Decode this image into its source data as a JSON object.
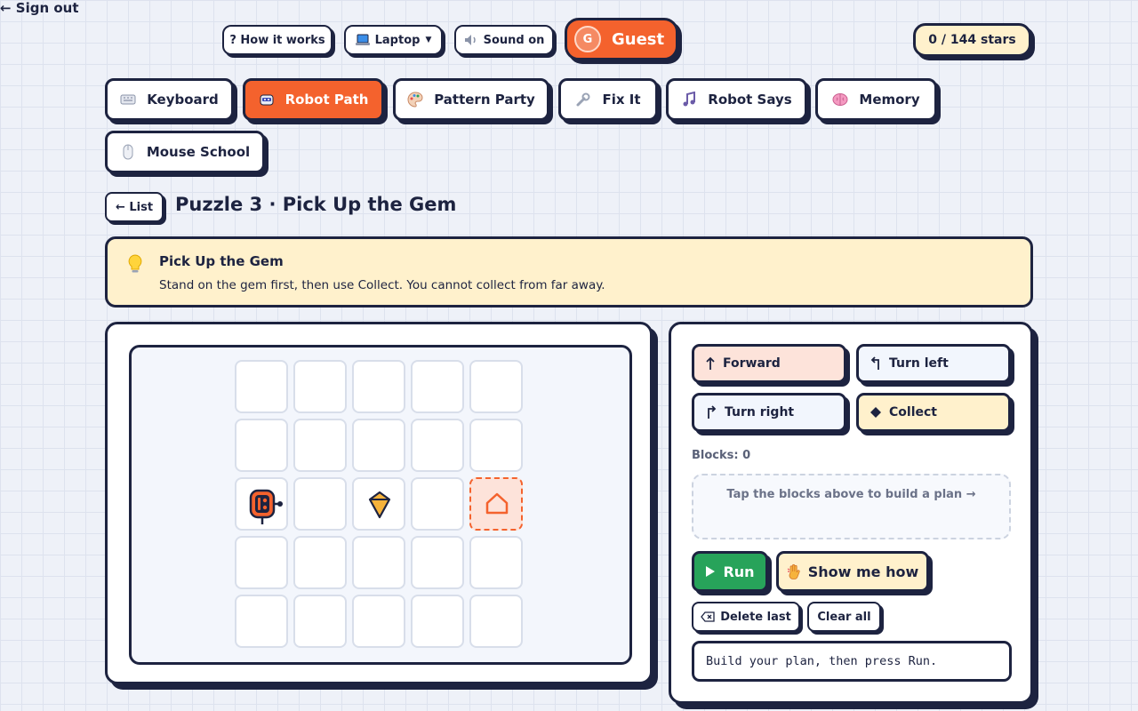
{
  "header": {
    "sign_out": "← Sign out",
    "how_it_works": "? How it works",
    "device": "Laptop",
    "sound": "Sound on",
    "user_initial": "G",
    "user_name": "Guest",
    "stars": "0 / 144 stars"
  },
  "tabs": [
    {
      "label": "Keyboard",
      "icon": "keyboard-icon",
      "active": false
    },
    {
      "label": "Robot Path",
      "icon": "robot-icon",
      "active": true
    },
    {
      "label": "Pattern Party",
      "icon": "palette-icon",
      "active": false
    },
    {
      "label": "Fix It",
      "icon": "wrench-icon",
      "active": false
    },
    {
      "label": "Robot Says",
      "icon": "music-note-icon",
      "active": false
    },
    {
      "label": "Memory",
      "icon": "brain-icon",
      "active": false
    },
    {
      "label": "Mouse School",
      "icon": "mouse-icon",
      "active": false
    }
  ],
  "puzzle": {
    "back_label": "← List",
    "title": "Puzzle 3 · Pick Up the Gem"
  },
  "hint": {
    "title": "Pick Up the Gem",
    "text": "Stand on the gem first, then use Collect. You cannot collect from far away."
  },
  "board": {
    "rows": 5,
    "cols": 5,
    "robot": {
      "row": 3,
      "col": 1,
      "facing": "right"
    },
    "gem": {
      "row": 3,
      "col": 3
    },
    "home": {
      "row": 3,
      "col": 5
    }
  },
  "commands": [
    {
      "label": "Forward",
      "icon": "arrow-up-icon"
    },
    {
      "label": "Turn left",
      "icon": "turn-left-icon"
    },
    {
      "label": "Turn right",
      "icon": "turn-right-icon"
    },
    {
      "label": "Collect",
      "icon": "diamond-icon"
    }
  ],
  "plan": {
    "blocks_label": "Blocks: 0",
    "empty_text": "Tap the blocks above to build a plan →"
  },
  "actions": {
    "run": "Run",
    "show_me": "Show me how",
    "delete_last": "Delete last",
    "clear_all": "Clear all"
  },
  "status": "Build your plan, then press Run.",
  "colors": {
    "accent": "#f4622d",
    "ink": "#1d2340",
    "run_green": "#27a35a",
    "hint_bg": "#fff1cc",
    "forward_bg": "#fde3da",
    "turn_bg": "#f2f6fd",
    "collect_bg": "#fff1cc"
  }
}
